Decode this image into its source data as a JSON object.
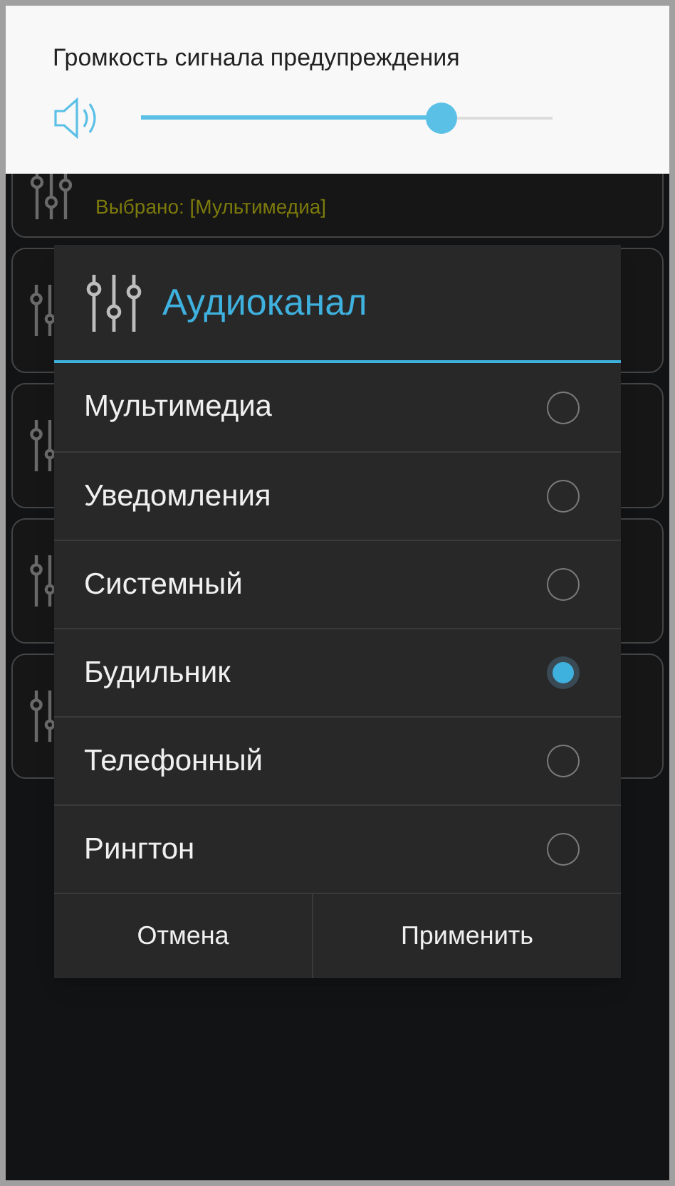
{
  "volume_panel": {
    "title": "Громкость сигнала предупреждения",
    "level": 0.73
  },
  "background_list": {
    "items": [
      {
        "subtitle": "Выбрано: [Мультимедиа]"
      }
    ]
  },
  "dialog": {
    "title": "Аудиоканал",
    "options": [
      {
        "label": "Мультимедиа",
        "selected": false
      },
      {
        "label": "Уведомления",
        "selected": false
      },
      {
        "label": "Системный",
        "selected": false
      },
      {
        "label": "Будильник",
        "selected": true
      },
      {
        "label": "Телефонный",
        "selected": false
      },
      {
        "label": "Рингтон",
        "selected": false
      }
    ],
    "buttons": [
      "Отмена",
      "Применить"
    ]
  }
}
